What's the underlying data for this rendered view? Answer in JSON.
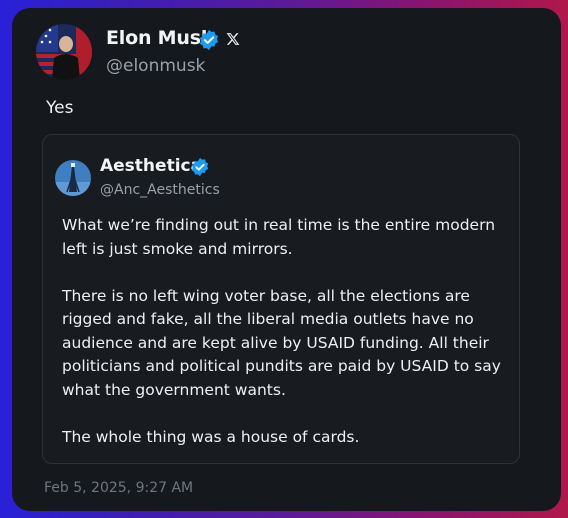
{
  "author": {
    "name": "Elon Musk",
    "handle": "@elonmusk",
    "verified": true,
    "platform_icon": "x-logo-icon"
  },
  "post": {
    "text": "Yes",
    "timestamp": "Feb 5, 2025, 9:27 AM"
  },
  "quoted": {
    "author_name": "Aesthetica",
    "author_handle": "@Anc_Aesthetics",
    "verified": true,
    "paragraphs": [
      "What we’re finding out in real time is the entire modern left is just smoke and mirrors.",
      "There is no left wing voter base, all the elections are rigged and fake, all the liberal media outlets have no audience and are kept alive by USAID funding. All their politicians and political pundits are paid by USAID to say what the government wants.",
      "The whole thing was a house of cards."
    ]
  },
  "colors": {
    "card_bg": "#15181c",
    "verified_blue": "#1d9bf0"
  }
}
